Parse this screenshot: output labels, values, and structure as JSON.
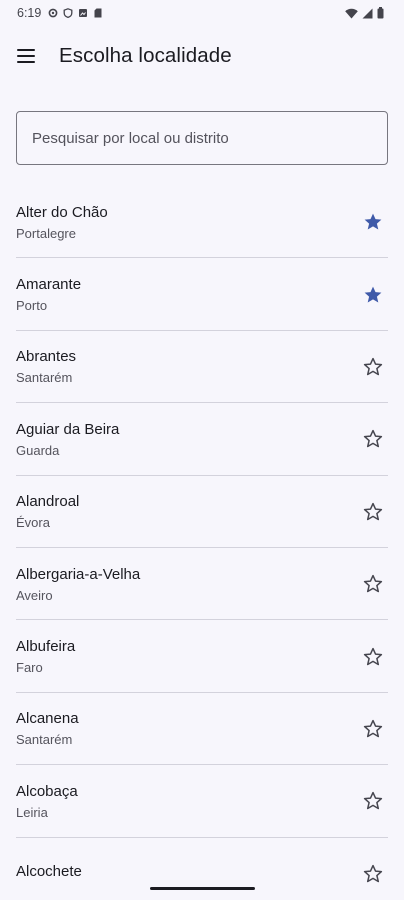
{
  "status_bar": {
    "time": "6:19",
    "left_icons": [
      "settings-icon",
      "shield-icon",
      "photo-icon",
      "sim-card-icon"
    ],
    "right_icons": [
      "wifi-icon",
      "signal-icon",
      "battery-icon"
    ]
  },
  "app_bar": {
    "menu_icon": "menu-icon",
    "title": "Escolha localidade"
  },
  "search": {
    "placeholder": "Pesquisar por local ou distrito",
    "value": ""
  },
  "colors": {
    "accent": "#3f5aa9",
    "background": "#f7f6fc",
    "divider": "#d3d2dc"
  },
  "locations": [
    {
      "name": "Alter do Chão",
      "district": "Portalegre",
      "favorite": true
    },
    {
      "name": "Amarante",
      "district": "Porto",
      "favorite": true
    },
    {
      "name": "Abrantes",
      "district": "Santarém",
      "favorite": false
    },
    {
      "name": "Aguiar da Beira",
      "district": "Guarda",
      "favorite": false
    },
    {
      "name": "Alandroal",
      "district": "Évora",
      "favorite": false
    },
    {
      "name": "Albergaria-a-Velha",
      "district": "Aveiro",
      "favorite": false
    },
    {
      "name": "Albufeira",
      "district": "Faro",
      "favorite": false
    },
    {
      "name": "Alcanena",
      "district": "Santarém",
      "favorite": false
    },
    {
      "name": "Alcobaça",
      "district": "Leiria",
      "favorite": false
    },
    {
      "name": "Alcochete",
      "district": "",
      "favorite": false
    }
  ]
}
